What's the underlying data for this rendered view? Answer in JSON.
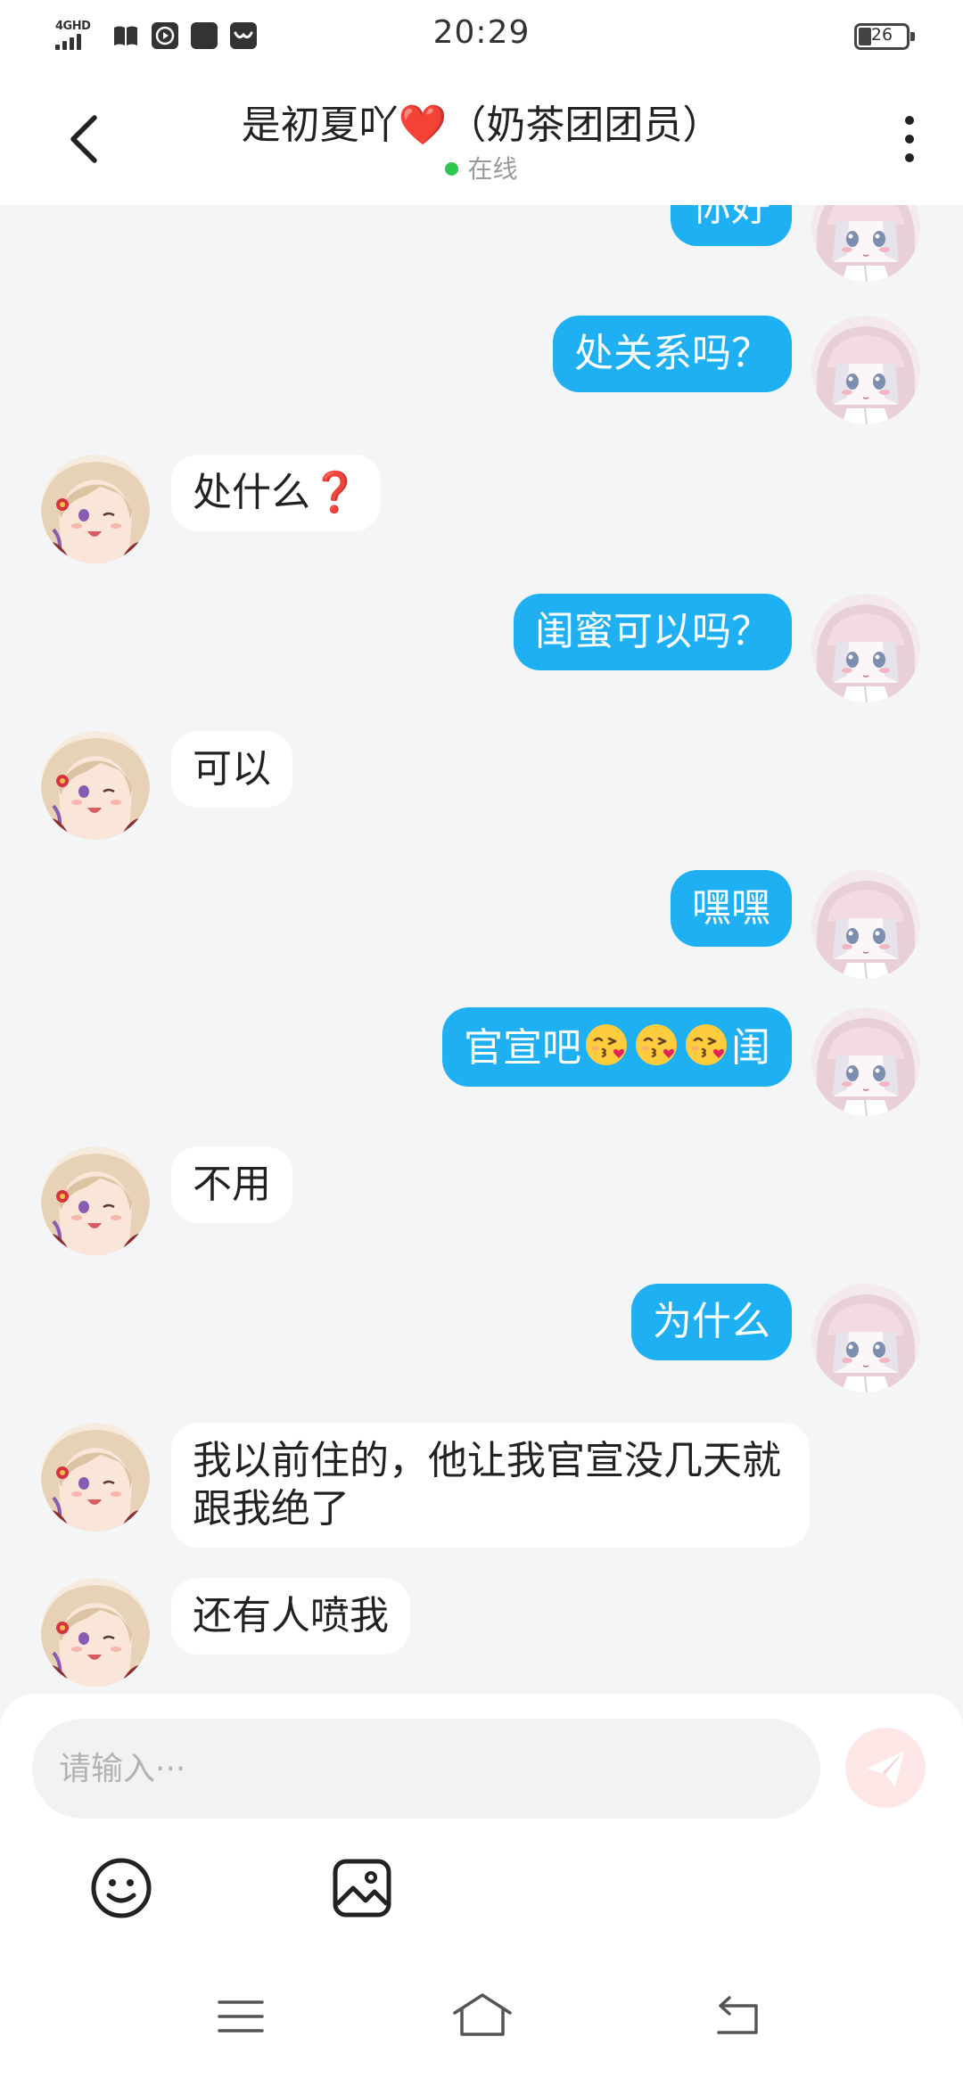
{
  "status_bar": {
    "network": "4GHD",
    "time": "20:29",
    "battery": "26",
    "battery_level": 0.26,
    "icons": [
      "signal-icon",
      "book-icon",
      "play-icon",
      "app-icon",
      "chat-app-icon"
    ]
  },
  "header": {
    "title": "是初夏吖❤️（奶茶团团员）",
    "status": "在线",
    "back_icon": "chevron-left-icon",
    "more_icon": "more-vertical-icon"
  },
  "messages": [
    {
      "sender": "me",
      "text": "你好"
    },
    {
      "sender": "me",
      "text": "处关系吗？"
    },
    {
      "sender": "them",
      "text": "处什么❓"
    },
    {
      "sender": "me",
      "text": "闺蜜可以吗？"
    },
    {
      "sender": "them",
      "text": "可以"
    },
    {
      "sender": "me",
      "text": "嘿嘿"
    },
    {
      "sender": "me",
      "text_before": "官宣吧",
      "emoji": "kissing-face-emoji",
      "emoji_count": 3,
      "text_after": "闺"
    },
    {
      "sender": "them",
      "text": "不用"
    },
    {
      "sender": "me",
      "text": "为什么"
    },
    {
      "sender": "them",
      "text": "我以前住的，他让我官宣没几天就跟我绝了"
    },
    {
      "sender": "them",
      "text": "还有人喷我"
    }
  ],
  "input": {
    "placeholder": "请输入···",
    "value": "",
    "send_icon": "send-icon",
    "emoji_icon": "smiley-icon",
    "image_icon": "image-icon"
  },
  "nav_bar": {
    "icons": [
      "menu-icon",
      "home-icon",
      "back-icon"
    ]
  },
  "colors": {
    "my_bubble": "#1eb0f3",
    "their_bubble": "#ffffff",
    "chat_background": "#f4f5f7",
    "online": "#2dc84d",
    "send_button": "#fde6e6"
  }
}
